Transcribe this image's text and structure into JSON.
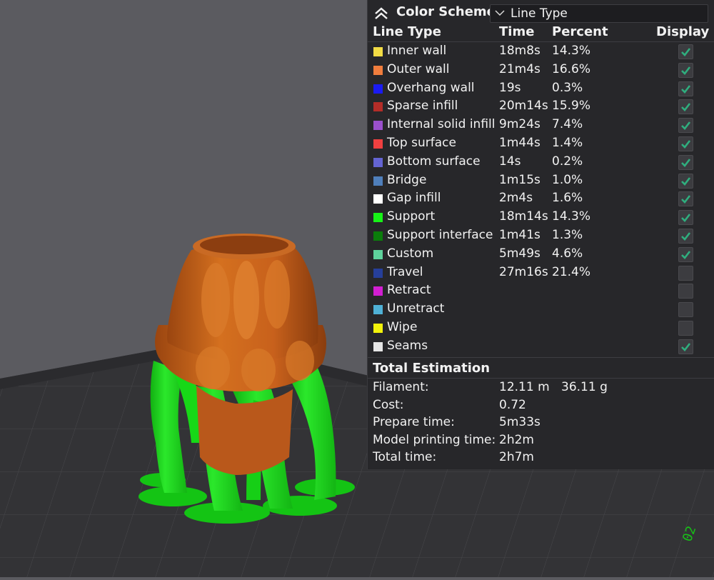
{
  "header": {
    "title": "Color Scheme",
    "dropdown_value": "Line Type"
  },
  "columns": {
    "line_type": "Line Type",
    "time": "Time",
    "percent": "Percent",
    "display": "Display"
  },
  "rows": [
    {
      "name": "Inner wall",
      "time": "18m8s",
      "percent": "14.3%",
      "color": "#f2dc45",
      "checked": true
    },
    {
      "name": "Outer wall",
      "time": "21m4s",
      "percent": "16.6%",
      "color": "#f07d3d",
      "checked": true
    },
    {
      "name": "Overhang wall",
      "time": "19s",
      "percent": "0.3%",
      "color": "#1b1bf2",
      "checked": true
    },
    {
      "name": "Sparse infill",
      "time": "20m14s",
      "percent": "15.9%",
      "color": "#b42d28",
      "checked": true
    },
    {
      "name": "Internal solid infill",
      "time": "9m24s",
      "percent": "7.4%",
      "color": "#9b50cd",
      "checked": true
    },
    {
      "name": "Top surface",
      "time": "1m44s",
      "percent": "1.4%",
      "color": "#f04040",
      "checked": true
    },
    {
      "name": "Bottom surface",
      "time": "14s",
      "percent": "0.2%",
      "color": "#6464d2",
      "checked": true
    },
    {
      "name": "Bridge",
      "time": "1m15s",
      "percent": "1.0%",
      "color": "#4f7fbb",
      "checked": true
    },
    {
      "name": "Gap infill",
      "time": "2m4s",
      "percent": "1.6%",
      "color": "#ffffff",
      "checked": true
    },
    {
      "name": "Support",
      "time": "18m14s",
      "percent": "14.3%",
      "color": "#17f217",
      "checked": true
    },
    {
      "name": "Support interface",
      "time": "1m41s",
      "percent": "1.3%",
      "color": "#0b7d0b",
      "checked": true
    },
    {
      "name": "Custom",
      "time": "5m49s",
      "percent": "4.6%",
      "color": "#5ed29c",
      "checked": true
    },
    {
      "name": "Travel",
      "time": "27m16s",
      "percent": "21.4%",
      "color": "#263f9a",
      "checked": false
    },
    {
      "name": "Retract",
      "time": "",
      "percent": "",
      "color": "#d21ed2",
      "checked": false
    },
    {
      "name": "Unretract",
      "time": "",
      "percent": "",
      "color": "#4fb1d6",
      "checked": false
    },
    {
      "name": "Wipe",
      "time": "",
      "percent": "",
      "color": "#f2f20b",
      "checked": false
    },
    {
      "name": "Seams",
      "time": "",
      "percent": "",
      "color": "#e6e6e6",
      "checked": true
    }
  ],
  "total": {
    "title": "Total Estimation",
    "rows": [
      {
        "label": "Filament:",
        "value": "12.11 m",
        "value2": "36.11 g"
      },
      {
        "label": "Cost:",
        "value": "0.72",
        "value2": ""
      },
      {
        "label": "Prepare time:",
        "value": "5m33s",
        "value2": ""
      },
      {
        "label": "Model printing time:",
        "value": "2h2m",
        "value2": ""
      },
      {
        "label": "Total time:",
        "value": "2h7m",
        "value2": ""
      }
    ]
  },
  "viewport": {
    "plate_label": "02"
  },
  "colors": {
    "panel_bg": "#27272a",
    "check_green": "#2fae7e",
    "model_orange": "#c8611c",
    "support_green": "#1fd81f",
    "background": "#5b5b60",
    "plate": "#333336"
  }
}
